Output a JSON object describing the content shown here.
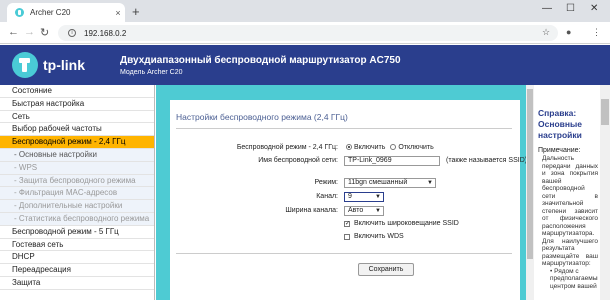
{
  "browser": {
    "tab_title": "Archer C20",
    "url": "192.168.0.2",
    "new_tab": "+",
    "tab_close": "×"
  },
  "router": {
    "brand": "tp-link",
    "title": "Двухдиапазонный беспроводной маршрутизатор AC750",
    "model": "Модель Archer C20"
  },
  "menu": [
    {
      "label": "Состояние",
      "type": "main"
    },
    {
      "label": "Быстрая настройка",
      "type": "main"
    },
    {
      "label": "Сеть",
      "type": "main"
    },
    {
      "label": "Выбор рабочей частоты",
      "type": "main"
    },
    {
      "label": "Беспроводной режим - 2,4 ГГц",
      "type": "active"
    },
    {
      "label": "- Основные настройки",
      "type": "sub"
    },
    {
      "label": "- WPS",
      "type": "subgray"
    },
    {
      "label": "- Защита беспроводного режима",
      "type": "subgray"
    },
    {
      "label": "- Фильтрация MAC-адресов",
      "type": "subgray"
    },
    {
      "label": "- Дополнительные настройки",
      "type": "subgray"
    },
    {
      "label": "- Статистика беспроводного режима",
      "type": "subgray"
    },
    {
      "label": "Беспроводной режим - 5 ГГц",
      "type": "main"
    },
    {
      "label": "Гостевая сеть",
      "type": "main"
    },
    {
      "label": "DHCP",
      "type": "main"
    },
    {
      "label": "Переадресация",
      "type": "main"
    },
    {
      "label": "Защита",
      "type": "main"
    }
  ],
  "form": {
    "title": "Настройки беспроводного режима (2,4 ГГц)",
    "radio_label": "Беспроводной режим - 2,4 ГГц:",
    "radio_on": "Включить",
    "radio_off": "Отключить",
    "ssid_label": "Имя беспроводной сети:",
    "ssid_value": "TP-Link_0969",
    "ssid_note": "(также называется SSID)",
    "mode_label": "Режим:",
    "mode_value": "11bgn смешанный",
    "channel_label": "Канал:",
    "channel_value": "9",
    "width_label": "Ширина канала:",
    "width_value": "Авто",
    "broadcast_label": "Включить широковещание SSID",
    "wds_label": "Включить WDS",
    "save": "Сохранить"
  },
  "help": {
    "title": "Справка: Основные настройки",
    "subtitle": "Примечание:",
    "body": "Дальность передачи данных и зона покрытия вашей беспроводной сети в значительной степени зависит от физического расположения маршрутизатора. Для наилучшего результата размещайте ваш маршрутизатор:",
    "bullet": "• Рядом с предполагаемым центром вашей"
  }
}
